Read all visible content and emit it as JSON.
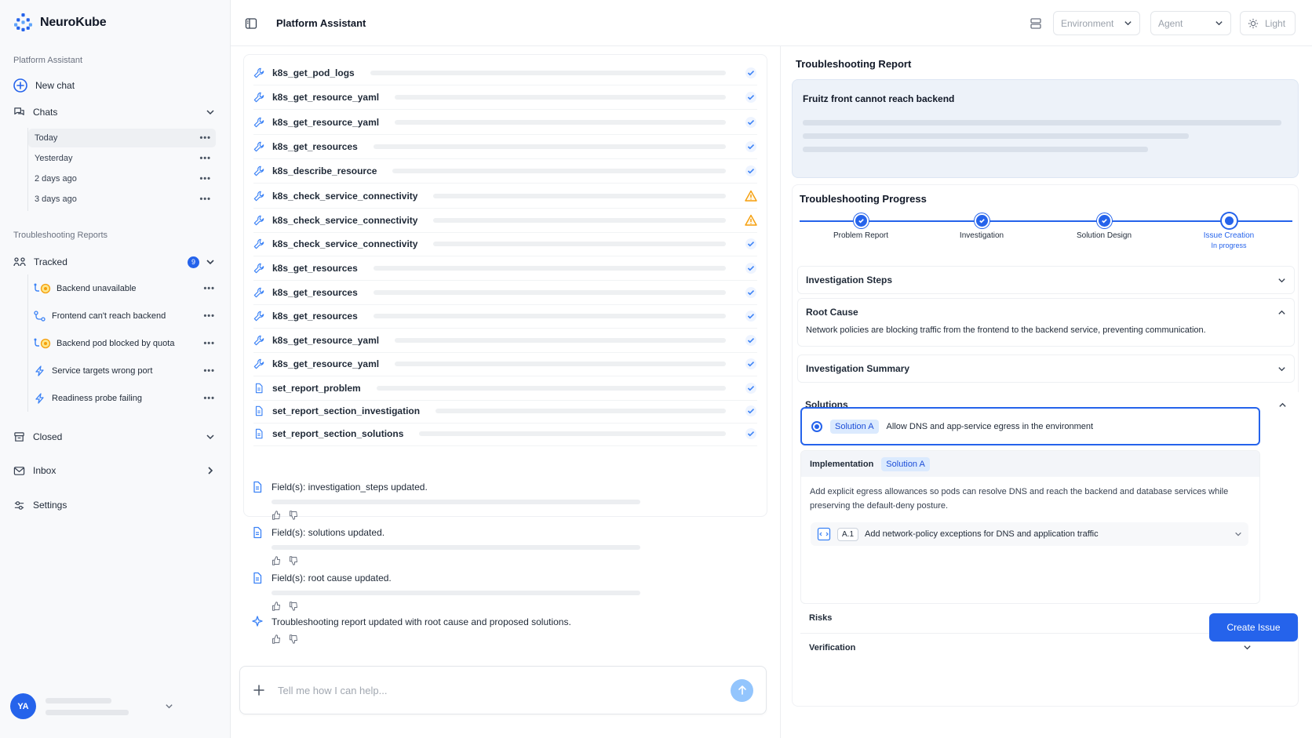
{
  "app": {
    "name": "NeuroKube"
  },
  "sidebar": {
    "assistant_label": "Platform Assistant",
    "new_chat": "New chat",
    "chats_label": "Chats",
    "chat_groups": [
      {
        "label": "Today"
      },
      {
        "label": "Yesterday"
      },
      {
        "label": "2 days ago"
      },
      {
        "label": "3 days ago"
      }
    ],
    "reports_label": "Troubleshooting Reports",
    "tracked_label": "Tracked",
    "tracked_count": "9",
    "tracked_items": [
      {
        "label": "Backend unavailable"
      },
      {
        "label": "Frontend can't reach backend"
      },
      {
        "label": "Backend pod blocked by quota"
      },
      {
        "label": "Service targets wrong port"
      },
      {
        "label": "Readiness probe failing"
      }
    ],
    "closed_label": "Closed",
    "inbox_label": "Inbox",
    "settings_label": "Settings",
    "user_initials": "YA"
  },
  "header": {
    "title": "Platform Assistant",
    "environment_placeholder": "Environment",
    "agent_placeholder": "Agent",
    "theme_label": "Light"
  },
  "chat": {
    "tool_calls": [
      {
        "name": "k8s_get_pod_logs",
        "status": "success",
        "icon": "wrench"
      },
      {
        "name": "k8s_get_resource_yaml",
        "status": "success",
        "icon": "wrench"
      },
      {
        "name": "k8s_get_resource_yaml",
        "status": "success",
        "icon": "wrench"
      },
      {
        "name": "k8s_get_resources",
        "status": "success",
        "icon": "wrench"
      },
      {
        "name": "k8s_describe_resource",
        "status": "success",
        "icon": "wrench"
      },
      {
        "name": "k8s_check_service_connectivity",
        "status": "warning",
        "icon": "wrench"
      },
      {
        "name": "k8s_check_service_connectivity",
        "status": "warning",
        "icon": "wrench"
      },
      {
        "name": "k8s_check_service_connectivity",
        "status": "success",
        "icon": "wrench"
      },
      {
        "name": "k8s_get_resources",
        "status": "success",
        "icon": "wrench"
      },
      {
        "name": "k8s_get_resources",
        "status": "success",
        "icon": "wrench"
      },
      {
        "name": "k8s_get_resources",
        "status": "success",
        "icon": "wrench"
      },
      {
        "name": "k8s_get_resource_yaml",
        "status": "success",
        "icon": "wrench"
      },
      {
        "name": "k8s_get_resource_yaml",
        "status": "success",
        "icon": "wrench"
      },
      {
        "name": "set_report_problem",
        "status": "success",
        "icon": "document"
      },
      {
        "name": "set_report_section_investigation",
        "status": "success",
        "icon": "document"
      },
      {
        "name": "set_report_section_solutions",
        "status": "success",
        "icon": "document"
      }
    ],
    "messages": [
      {
        "text": "Field(s): investigation_steps updated."
      },
      {
        "text": "Field(s): solutions updated."
      },
      {
        "text": "Field(s): root cause updated."
      },
      {
        "text": "Troubleshooting report updated with root cause and proposed solutions."
      }
    ],
    "input_placeholder": "Tell me how I can help..."
  },
  "report": {
    "title": "Troubleshooting Report",
    "problem_title": "Fruitz front cannot reach backend",
    "progress_title": "Troubleshooting Progress",
    "steps": [
      {
        "label": "Problem Report",
        "status": "done"
      },
      {
        "label": "Investigation",
        "status": "done"
      },
      {
        "label": "Solution Design",
        "status": "done"
      },
      {
        "label": "Issue Creation",
        "status": "current",
        "sub": "In progress"
      }
    ],
    "investigation_steps_label": "Investigation Steps",
    "root_cause_label": "Root Cause",
    "root_cause_text": "Network policies are blocking traffic from the frontend to the backend service, preventing communication.",
    "investigation_summary_label": "Investigation Summary",
    "solutions_label": "Solutions",
    "solution": {
      "chip": "Solution A",
      "text": "Allow DNS and app-service egress in the environment"
    },
    "implementation": {
      "label": "Implementation",
      "chip": "Solution A",
      "text": "Add explicit egress allowances so pods can resolve DNS and reach the backend and database services while preserving the default-deny posture.",
      "step_id": "A.1",
      "step_text": "Add network-policy exceptions for DNS and application traffic"
    },
    "risks_label": "Risks",
    "verification_label": "Verification",
    "create_issue": "Create Issue"
  },
  "colors": {
    "accent": "#2563eb",
    "warning": "#f59e0b",
    "success_check": "#3b82f6"
  }
}
